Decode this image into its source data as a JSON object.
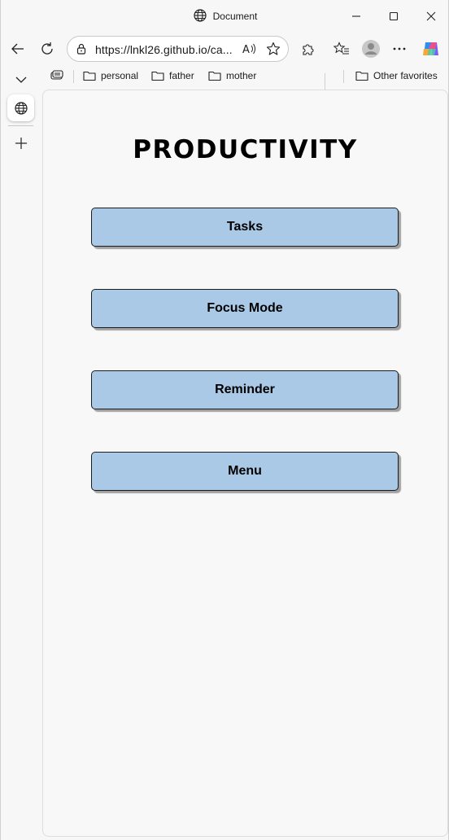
{
  "window": {
    "title": "Document",
    "icons": [
      "globe-icon",
      "minimize-icon",
      "maximize-icon",
      "close-icon"
    ]
  },
  "toolbar": {
    "url": "https://lnkl26.github.io/ca...",
    "icons": [
      "back-icon",
      "refresh-icon",
      "lock-icon",
      "read-aloud-icon",
      "favorite-star-icon",
      "extensions-icon",
      "favorites-icon",
      "profile-icon",
      "more-icon",
      "copilot-icon"
    ]
  },
  "favorites": {
    "items": [
      {
        "label": "personal"
      },
      {
        "label": "father"
      },
      {
        "label": "mother"
      }
    ],
    "other": "Other favorites"
  },
  "sidebar": {
    "icons": [
      "tab-actions-chevron-icon",
      "globe-tab-icon",
      "add-tab-icon"
    ]
  },
  "page": {
    "title": "PRODUCTIVITY",
    "buttons": [
      {
        "label": "Tasks"
      },
      {
        "label": "Focus Mode"
      },
      {
        "label": "Reminder"
      },
      {
        "label": "Menu"
      }
    ],
    "button_color": "#a9c9e6"
  }
}
